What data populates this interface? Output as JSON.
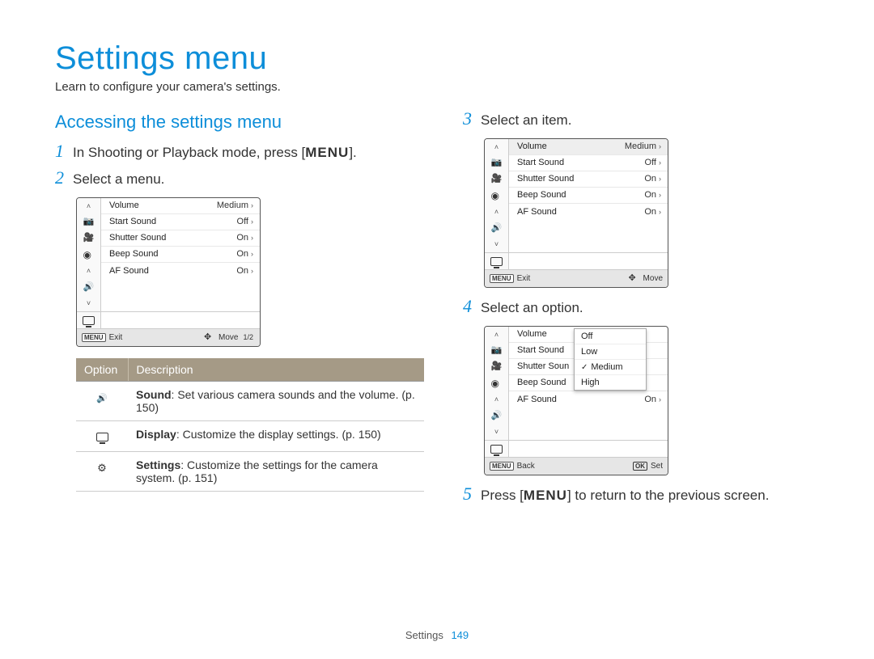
{
  "title": "Settings menu",
  "intro": "Learn to configure your camera's settings.",
  "section_heading": "Accessing the settings menu",
  "steps": {
    "s1": {
      "num": "1",
      "pre": "In Shooting or Playback mode, press [",
      "menu": "MENU",
      "post": "]."
    },
    "s2": {
      "num": "2",
      "text": "Select a menu."
    },
    "s3": {
      "num": "3",
      "text": "Select an item."
    },
    "s4": {
      "num": "4",
      "text": "Select an option."
    },
    "s5": {
      "num": "5",
      "pre": "Press [",
      "menu": "MENU",
      "post": "] to return to the previous screen."
    }
  },
  "lcd_rows": {
    "r0": {
      "label": "Volume",
      "value": "Medium"
    },
    "r1": {
      "label": "Start Sound",
      "value": "Off"
    },
    "r2": {
      "label": "Shutter Sound",
      "value": "On"
    },
    "r3": {
      "label": "Beep Sound",
      "value": "On"
    },
    "r4": {
      "label": "AF Sound",
      "value": "On"
    }
  },
  "lcd_foot": {
    "exit": "Exit",
    "move": "Move",
    "back": "Back",
    "set": "Set",
    "page": "1/2",
    "menu_tag": "MENU",
    "ok_tag": "OK"
  },
  "lcd4_rows": {
    "r0": "Volume",
    "r1": "Start Sound",
    "r2": "Shutter Soun",
    "r3": "Beep Sound",
    "r4": "AF Sound",
    "r4v": "On"
  },
  "dropdown": {
    "d0": "Off",
    "d1": "Low",
    "d2": "Medium",
    "d3": "High"
  },
  "table": {
    "header_option": "Option",
    "header_desc": "Description",
    "row_sound_b": "Sound",
    "row_sound_t": ": Set various camera sounds and the volume. (p. 150)",
    "row_display_b": "Display",
    "row_display_t": ": Customize the display settings. (p. 150)",
    "row_settings_b": "Settings",
    "row_settings_t": ": Customize the settings for the camera system. (p. 151)"
  },
  "footer": {
    "label": "Settings",
    "page": "149"
  }
}
